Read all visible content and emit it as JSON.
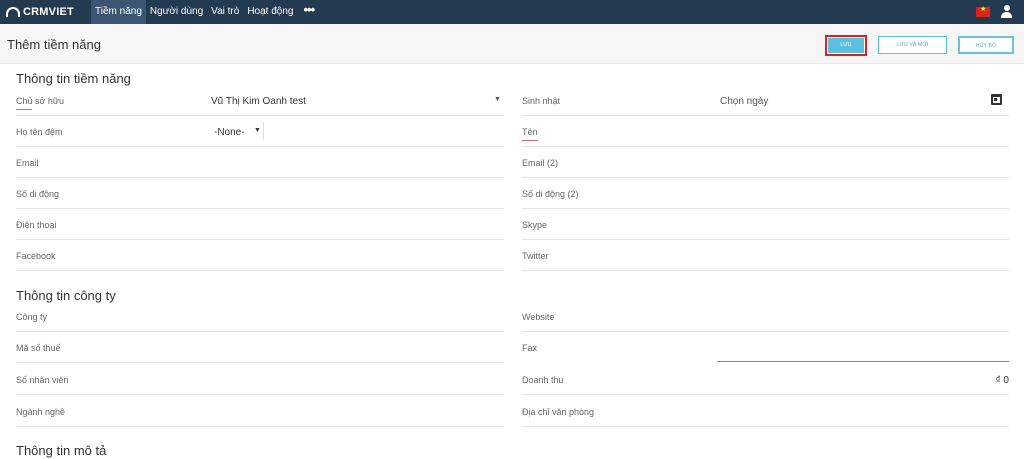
{
  "nav": {
    "logo": "CRMVIET",
    "items": [
      "Tiềm năng",
      "Người dùng",
      "Vai trò",
      "Hoạt động"
    ],
    "more": "•••"
  },
  "page": {
    "title": "Thêm tiềm năng",
    "buttons": {
      "save": "LƯU",
      "save_new": "LƯU VÀ MỚI",
      "cancel": "HỦY BỎ"
    }
  },
  "sections": {
    "lead_info": "Thông tin tiềm năng",
    "company_info": "Thông tin công ty",
    "description": "Thông tin mô tả"
  },
  "fields": {
    "owner": {
      "label": "Chủ sở hữu",
      "value": "Vũ Thị Kim Oanh test"
    },
    "birthday": {
      "label": "Sinh nhật",
      "placeholder": "Chọn ngày"
    },
    "middle_name": {
      "label": "Họ tên đệm",
      "value": "-None-"
    },
    "first_name": {
      "label": "Tên"
    },
    "email": {
      "label": "Email"
    },
    "email2": {
      "label": "Email (2)"
    },
    "mobile": {
      "label": "Số di động"
    },
    "mobile2": {
      "label": "Số di động (2)"
    },
    "phone": {
      "label": "Điện thoại"
    },
    "skype": {
      "label": "Skype"
    },
    "facebook": {
      "label": "Facebook"
    },
    "twitter": {
      "label": "Twitter"
    },
    "company": {
      "label": "Công ty"
    },
    "website": {
      "label": "Website"
    },
    "tax_code": {
      "label": "Mã số thuế"
    },
    "fax": {
      "label": "Fax"
    },
    "employees": {
      "label": "Số nhân viên"
    },
    "revenue": {
      "label": "Doanh thu",
      "value": "₫ 0"
    },
    "industry": {
      "label": "Ngành nghề"
    },
    "office_address": {
      "label": "Địa chỉ văn phòng"
    }
  },
  "colors": {
    "nav_bg": "#243a51",
    "accent": "#5bc0de",
    "required": "#e06666",
    "highlight": "#e02020"
  }
}
